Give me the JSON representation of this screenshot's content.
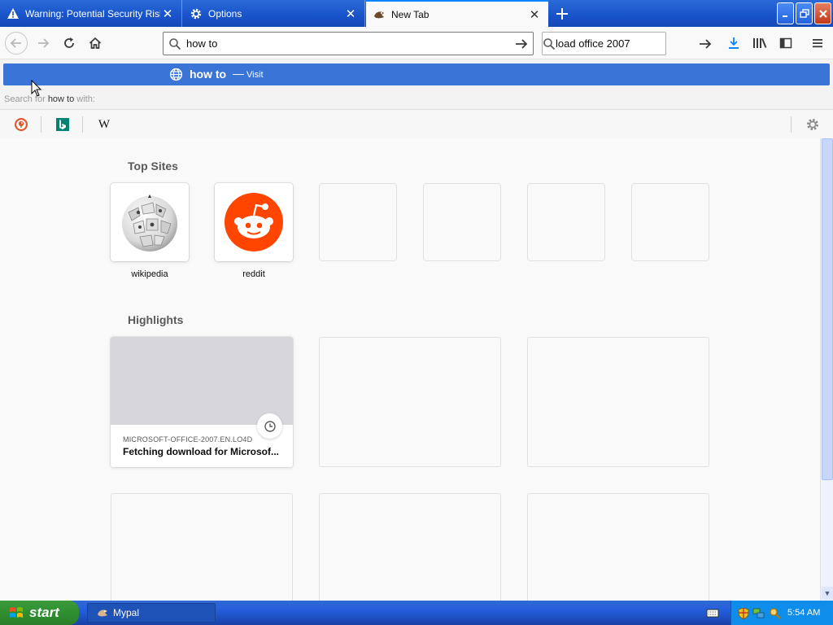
{
  "tabs": [
    {
      "title": "Warning: Potential Security Risk Ah",
      "icon": "warning-icon"
    },
    {
      "title": "Options",
      "icon": "gear-icon"
    },
    {
      "title": "New Tab",
      "icon": "mypal-icon",
      "active": true
    }
  ],
  "navbar": {
    "url_value": "how to",
    "search_value": "load office 2007"
  },
  "popup": {
    "suggestion_text": "how to",
    "suggestion_dash": "—",
    "suggestion_action": "Visit",
    "search_with_prefix": "Search for",
    "search_with_query": "how to",
    "search_with_suffix": "with:",
    "engines": [
      "DuckDuckGo",
      "Bing",
      "Wikipedia"
    ],
    "wikipedia_glyph": "W"
  },
  "content": {
    "top_sites_title": "Top Sites",
    "top_sites": [
      {
        "label": "wikipedia"
      },
      {
        "label": "reddit"
      },
      {
        "label": ""
      },
      {
        "label": ""
      },
      {
        "label": ""
      },
      {
        "label": ""
      }
    ],
    "highlights_title": "Highlights",
    "highlight_card": {
      "host": "MICROSOFT-OFFICE-2007.EN.LO4D",
      "title": "Fetching download for Microsof..."
    },
    "scroll_position": 0
  },
  "taskbar": {
    "start_label": "start",
    "task_label": "Mypal",
    "clock": "5:54 AM"
  },
  "colors": {
    "accent": "#0a84ff",
    "suggest_bg": "#3a74d6",
    "xp_blue": "#245edb",
    "start_green": "#2f8f2f",
    "reddit": "#ff4500"
  }
}
